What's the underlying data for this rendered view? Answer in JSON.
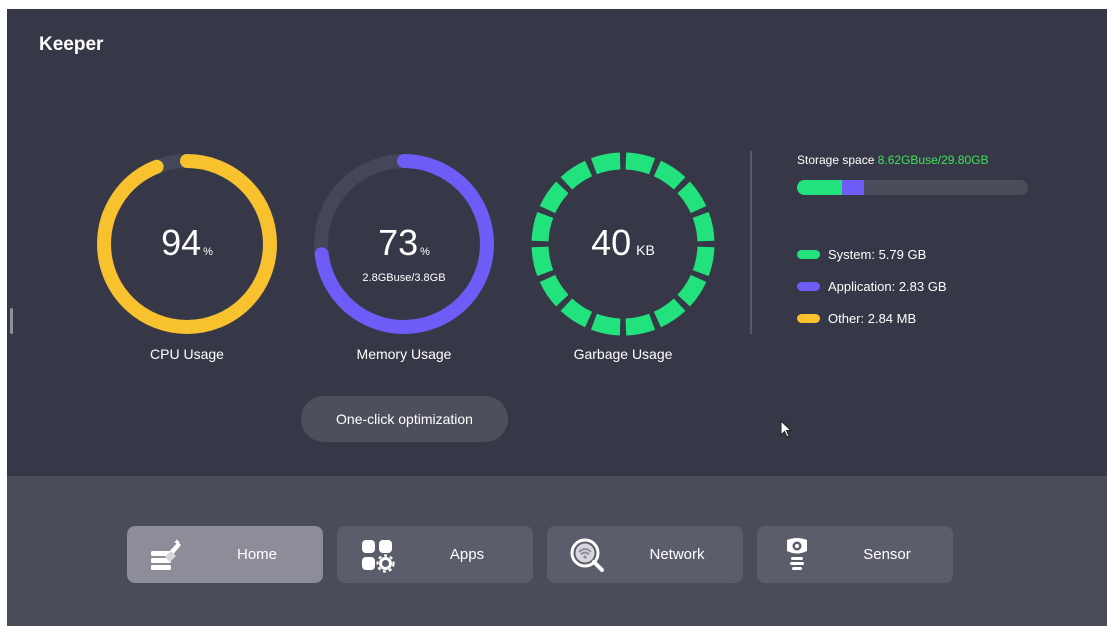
{
  "app": {
    "title": "Keeper"
  },
  "gauges": {
    "cpu": {
      "value": "94",
      "unit": "%",
      "label": "CPU Usage",
      "fraction": 0.94,
      "color": "#f8c12e"
    },
    "memory": {
      "value": "73",
      "unit": "%",
      "detail": "2.8GBuse/3.8GB",
      "label": "Memory Usage",
      "fraction": 0.73,
      "color": "#6d5cf6"
    },
    "garbage": {
      "value": "40",
      "unit": "KB",
      "label": "Garbage Usage",
      "color": "#22e27e"
    }
  },
  "storage": {
    "title": "Storage space",
    "value": "8.62GBuse/29.80GB",
    "used_fraction": 0.289,
    "legend": [
      {
        "label": "System: 5.79 GB",
        "color": "#22e27e",
        "gb": 5.79
      },
      {
        "label": "Application: 2.83 GB",
        "color": "#6d5cf6",
        "gb": 2.83
      },
      {
        "label": "Other: 2.84 MB",
        "color": "#f8c12e",
        "gb": 0.00284
      }
    ],
    "total_gb": 29.8
  },
  "actions": {
    "optimize_label": "One-click optimization"
  },
  "nav": [
    {
      "label": "Home",
      "icon": "broom-cleanup-icon",
      "active": true
    },
    {
      "label": "Apps",
      "icon": "apps-grid-gear-icon",
      "active": false
    },
    {
      "label": "Network",
      "icon": "network-search-icon",
      "active": false
    },
    {
      "label": "Sensor",
      "icon": "sensor-icon",
      "active": false
    }
  ]
}
